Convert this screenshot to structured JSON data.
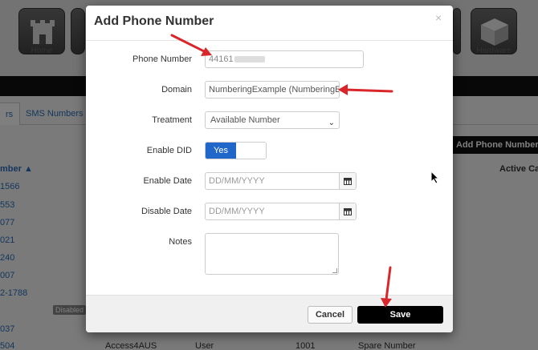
{
  "background": {
    "nav_tiles": [
      {
        "label": "Home",
        "icon": "castle-icon"
      },
      {
        "label": "Hardware",
        "icon": "box-icon"
      }
    ],
    "tabs": [
      {
        "label": "rs"
      },
      {
        "label": "SMS Numbers"
      }
    ],
    "add_button_label": "Add Phone Number",
    "col_number": "mber",
    "col_active": "Active Cal",
    "rows": [
      "1566",
      "553",
      "077",
      "021",
      "240",
      "007",
      "2-1788",
      "",
      "037",
      "504"
    ],
    "disabled_badge": "Disabled",
    "last_row_cells": [
      "Access4AUS",
      "User",
      "1001",
      "Spare Number"
    ]
  },
  "modal": {
    "title": "Add Phone Number",
    "close_glyph": "×",
    "phone_label": "Phone Number",
    "phone_value": "44161",
    "domain_label": "Domain",
    "domain_value": "NumberingExample (NumberingExample)",
    "treatment_label": "Treatment",
    "treatment_value": "Available Number",
    "did_label": "Enable DID",
    "did_value": "Yes",
    "enable_date_label": "Enable Date",
    "enable_date_placeholder": "DD/MM/YYYY",
    "disable_date_label": "Disable Date",
    "disable_date_placeholder": "DD/MM/YYYY",
    "notes_label": "Notes",
    "cancel_label": "Cancel",
    "save_label": "Save"
  },
  "colors": {
    "annotation_arrow": "#d9262b",
    "toggle_on": "#2067c9",
    "save_button": "#000000"
  }
}
